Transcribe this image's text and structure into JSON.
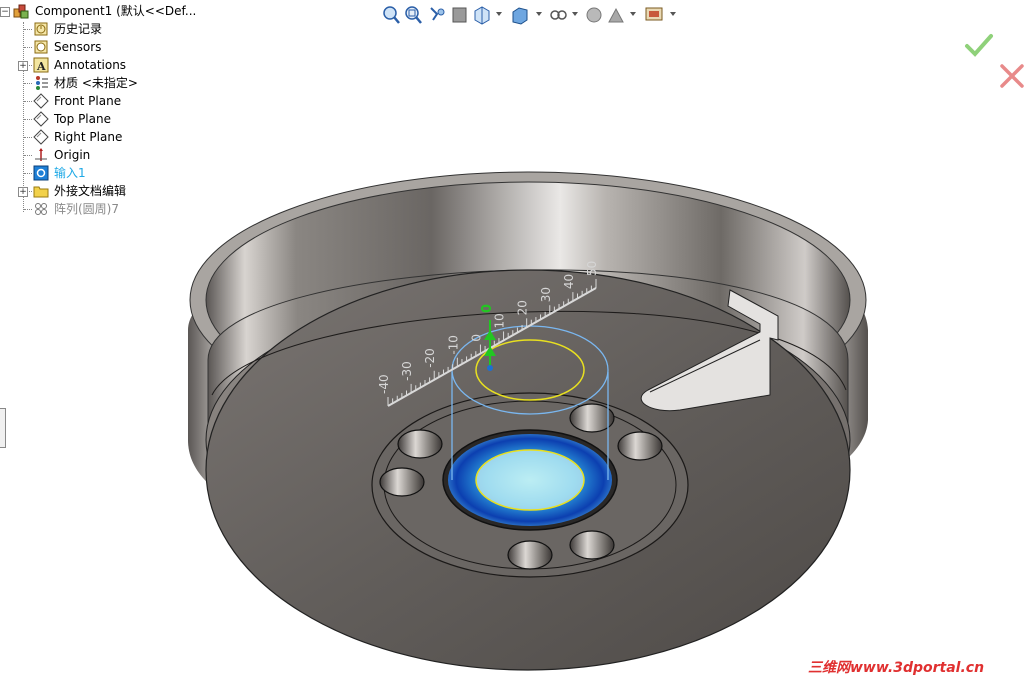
{
  "tree": {
    "root": {
      "label": "Component1  (默认<<Def..."
    },
    "items": [
      {
        "label": "历史记录",
        "icon": "history-icon",
        "expandable": false
      },
      {
        "label": "Sensors",
        "icon": "sensors-icon",
        "expandable": false
      },
      {
        "label": "Annotations",
        "icon": "annotations-icon",
        "expandable": true
      },
      {
        "label": "材质 <未指定>",
        "icon": "material-icon",
        "expandable": false
      },
      {
        "label": "Front Plane",
        "icon": "plane-icon",
        "expandable": false
      },
      {
        "label": "Top Plane",
        "icon": "plane-icon",
        "expandable": false
      },
      {
        "label": "Right Plane",
        "icon": "plane-icon",
        "expandable": false
      },
      {
        "label": "Origin",
        "icon": "origin-icon",
        "expandable": false
      },
      {
        "label": "输入1",
        "icon": "imported-body-icon",
        "expandable": false
      },
      {
        "label": "外接文档编辑",
        "icon": "folder-icon",
        "expandable": true
      },
      {
        "label": "阵列(圆周)7",
        "icon": "circular-pattern-icon",
        "expandable": false
      }
    ]
  },
  "ruler": {
    "value": "0",
    "ticks": [
      "-40",
      "-30",
      "-20",
      "-10",
      "0",
      "10",
      "20",
      "30",
      "40",
      "50"
    ]
  },
  "toolbar": {
    "buttons": [
      "zoom-to-fit-icon",
      "zoom-to-area-icon",
      "previous-view-icon",
      "section-view-icon",
      "view-orientation-icon",
      "display-style-icon",
      "hide-show-items-icon",
      "edit-appearance-icon",
      "apply-scene-icon",
      "view-settings-icon"
    ]
  },
  "watermark": "三维网www.3dportal.cn",
  "colors": {
    "highlight": "#1ea9e6",
    "ok_green": "#8fd17a",
    "cancel_red": "#e88a8a",
    "preview_green": "#22c622",
    "edge_yellow": "#e8e020"
  }
}
